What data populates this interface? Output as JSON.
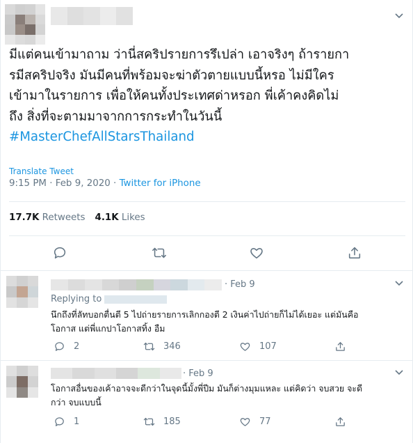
{
  "tweet": {
    "lines": [
      "มีแต่คนเข้ามาถาม ว่านี่สคริปรายการรึเปล่า เอาจริงๆ ถ้ารายกา",
      "รมีสคริปจริง มันมีคนที่พร้อมจะฆ่าตัวตายแบบนี้หรอ  ไม่มีใคร",
      "เข้ามาในรายการ เพื่อให้คนทั้งประเทศด่าหรอก พี่เค้าคงคิดไม่",
      "ถึง สิ่งที่จะตามมาจากการกระทำในวันนี้"
    ],
    "hashtag": "#MasterChefAllStarsThailand",
    "translate_label": "Translate Tweet",
    "timestamp": "9:15 PM · Feb 9, 2020 · ",
    "source": "Twitter for iPhone",
    "retweets_count": "17.7K",
    "retweets_label": " Retweets",
    "likes_count": "4.1K",
    "likes_label": " Likes",
    "icons": [
      "reply-icon",
      "retweet-icon",
      "like-icon",
      "share-icon"
    ]
  },
  "replies": [
    {
      "time": "· Feb 9",
      "replying_to": "Replying to",
      "lines": [
        "นึกถึงที่ลัทบอกตื่นตี 5 ไปถ่ายรายการเลิกกองตี 2 เงินค่าไปถ่ายก็ไม่ได้เยอะ แต่มันคือ",
        "โอกาส แต่พี่แกปาโอกาสทิ้ง อืม"
      ],
      "reply_count": "2",
      "retweet_count": "346",
      "like_count": "107"
    },
    {
      "time": "· Feb 9",
      "lines": [
        "โอกาสอื่นของเค้าอาจจะดีกว่าในจุดนี้มั้งพี่ปีม มันก็ต่างมุมแหละ แต่คิดว่า จบสวย จะดี",
        "กว่า จบแบบนี้"
      ],
      "reply_count": "1",
      "retweet_count": "185",
      "like_count": "77"
    }
  ],
  "colors": {
    "text": "#14171a",
    "secondary": "#657786",
    "link": "#1b95e0",
    "divider": "#e6ecf0"
  }
}
